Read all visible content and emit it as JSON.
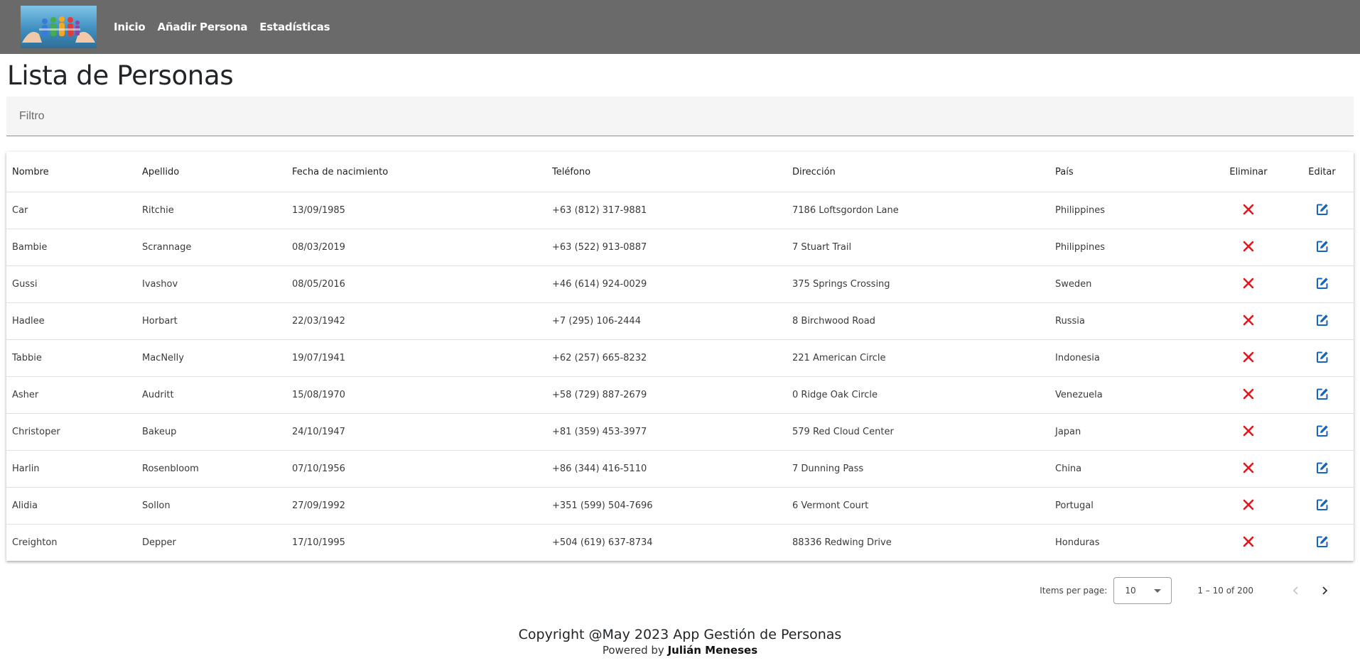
{
  "nav": {
    "links": [
      "Inicio",
      "Añadir Persona",
      "Estadísticas"
    ]
  },
  "page_title": "Lista de Personas",
  "filter": {
    "placeholder": "Filtro"
  },
  "table": {
    "headers": [
      "Nombre",
      "Apellido",
      "Fecha de nacimiento",
      "Teléfono",
      "Dirección",
      "País",
      "Eliminar",
      "Editar"
    ],
    "rows": [
      [
        "Car",
        "Ritchie",
        "13/09/1985",
        "+63 (812) 317-9881",
        "7186 Loftsgordon Lane",
        "Philippines"
      ],
      [
        "Bambie",
        "Scrannage",
        "08/03/2019",
        "+63 (522) 913-0887",
        "7 Stuart Trail",
        "Philippines"
      ],
      [
        "Gussi",
        "Ivashov",
        "08/05/2016",
        "+46 (614) 924-0029",
        "375 Springs Crossing",
        "Sweden"
      ],
      [
        "Hadlee",
        "Horbart",
        "22/03/1942",
        "+7 (295) 106-2444",
        "8 Birchwood Road",
        "Russia"
      ],
      [
        "Tabbie",
        "MacNelly",
        "19/07/1941",
        "+62 (257) 665-8232",
        "221 American Circle",
        "Indonesia"
      ],
      [
        "Asher",
        "Audritt",
        "15/08/1970",
        "+58 (729) 887-2679",
        "0 Ridge Oak Circle",
        "Venezuela"
      ],
      [
        "Christoper",
        "Bakeup",
        "24/10/1947",
        "+81 (359) 453-3977",
        "579 Red Cloud Center",
        "Japan"
      ],
      [
        "Harlin",
        "Rosenbloom",
        "07/10/1956",
        "+86 (344) 416-5110",
        "7 Dunning Pass",
        "China"
      ],
      [
        "Alidia",
        "Sollon",
        "27/09/1992",
        "+351 (599) 504-7696",
        "6 Vermont Court",
        "Portugal"
      ],
      [
        "Creighton",
        "Depper",
        "17/10/1995",
        "+504 (619) 637-8734",
        "88336 Redwing Drive",
        "Honduras"
      ]
    ]
  },
  "paginator": {
    "items_per_page_label": "Items per page:",
    "items_per_page_value": "10",
    "range": "1 – 10 of 200"
  },
  "footer": {
    "copyright": "Copyright @May 2023 App Gestión de Personas",
    "powered_prefix": "Powered by",
    "author": "Julián Meneses"
  },
  "colors": {
    "navbar": "#6b6a6b",
    "delete_icon": "#e8141c",
    "edit_icon": "#1565c0"
  },
  "icons": {
    "delete": "close-icon",
    "edit": "edit-icon",
    "prev": "chevron-left-icon",
    "next": "chevron-right-icon"
  }
}
